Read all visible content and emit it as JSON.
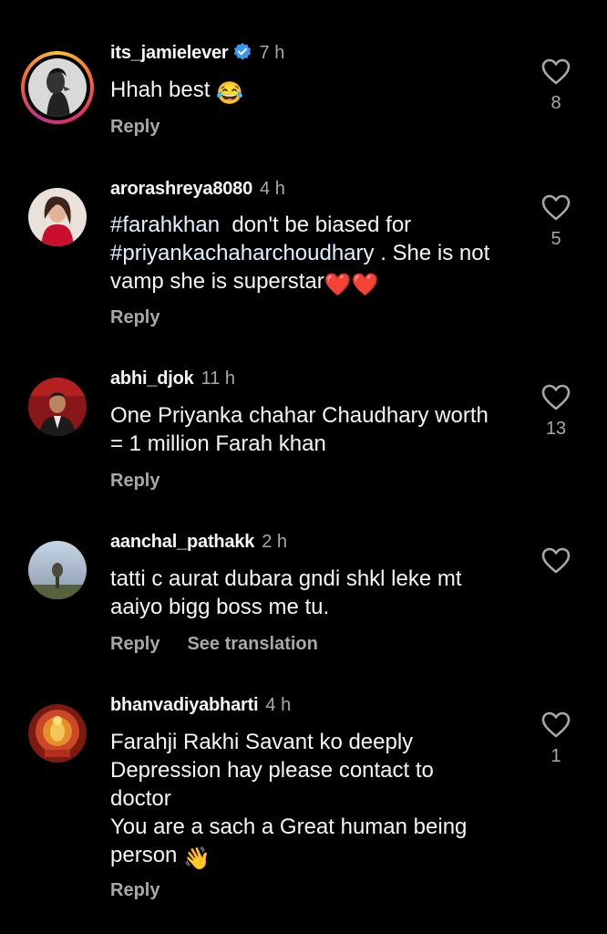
{
  "comments": [
    {
      "username": "its_jamielever",
      "verified": true,
      "time": "7 h",
      "text": "Hhah best",
      "emoji": "😂",
      "likes": "8",
      "reply": "Reply"
    },
    {
      "username": "arorashreya8080",
      "time": "4 h",
      "hashtag1": "#farahkhan",
      "text1": "  don't be biased for",
      "hashtag2": "#priyankachaharchoudhary",
      "text2": " . She is not vamp she is superstar",
      "emoji": "❤️❤️",
      "likes": "5",
      "reply": "Reply"
    },
    {
      "username": "abhi_djok",
      "time": "11 h",
      "line1": "One Priyanka chahar Chaudhary worth",
      "line2": "= 1 million Farah khan",
      "likes": "13",
      "reply": "Reply"
    },
    {
      "username": "aanchal_pathakk",
      "time": "2 h",
      "line1": "tatti c aurat dubara gndi shkl leke mt",
      "line2": "aaiyo bigg boss me tu.",
      "reply": "Reply",
      "translate": "See translation"
    },
    {
      "username": "bhanvadiyabharti",
      "time": "4 h",
      "line1": "Farahji Rakhi Savant ko deeply",
      "line2": "Depression hay please contact to",
      "line3": "doctor",
      "line4": "You are a sach a Great human being",
      "line5": "person",
      "emoji": "👋",
      "likes": "1",
      "reply": "Reply"
    }
  ],
  "colors": {
    "background": "#000000",
    "text": "#f5f5f5",
    "secondary": "#a8a8a8",
    "verified": "#3897f0",
    "heart_red": "#e0245e"
  }
}
